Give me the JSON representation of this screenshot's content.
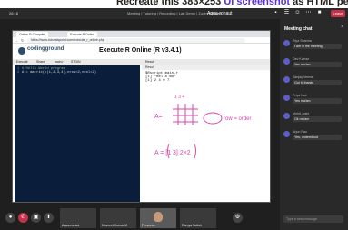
{
  "banner": {
    "part1": "Recreate this 383×253",
    "part2": "UI screenshot",
    "part3": " as HTML per the rules."
  },
  "meet": {
    "top_left": "26:16",
    "title": "Meeting | Tutoring | Recording | Lab Demo | Zoom Session",
    "presenter": "Aqua-ronaut",
    "leave_label": "Leave"
  },
  "browser": {
    "tabs": [
      "Online R Compiler",
      "Execute R Online"
    ],
    "url": "https://www.tutorialspoint.com/execute_r_online.php"
  },
  "ide": {
    "logo_text": "codingground",
    "title": "Execute R Online (R v3.4.1)",
    "toolbar": [
      "Execute",
      "Share",
      "main.r",
      "STDIN",
      "Result"
    ],
    "code_lines": [
      {
        "n": "1",
        "text": "# Hello World program",
        "comment": true
      },
      {
        "n": "2",
        "text": "A = matrix(c(1,2,3,4),nrow=2,ncol=2)",
        "comment": false
      }
    ],
    "result_bar": "Result",
    "result_text": "$Rscript main.r\n[1] \"Hello Wo\"\n[1] 2 4 0 7"
  },
  "whiteboard": {
    "label_top": "1 3 4",
    "label_A": "A=",
    "label_rowcol": "row = order",
    "label_B": "A = [1 3] 2×2"
  },
  "chat": {
    "header": "Meeting chat",
    "messages": [
      {
        "name": "Riya Sharma",
        "text": "I am in the meeting"
      },
      {
        "name": "Dev Kumar",
        "text": "Yes ma'am"
      },
      {
        "name": "Sanjay Verma",
        "text": "Got it, thanks"
      },
      {
        "name": "Priya Nair",
        "text": "Yes ma'am"
      },
      {
        "name": "Mohit Joshi",
        "text": "Ok ma'am"
      },
      {
        "name": "Arjun Rao",
        "text": "Yes, understood"
      }
    ],
    "compose_placeholder": "Type a new message"
  },
  "participants": [
    {
      "name": "Aqua-ronaut"
    },
    {
      "name": "Navneet Kumar M"
    },
    {
      "name": "Presenter"
    },
    {
      "name": "Ramya Satish"
    }
  ],
  "colors": {
    "banner_dark": "#24201c",
    "banner_accent": "#5a2de0",
    "meet_bg": "#1f1f1f",
    "leave": "#c4314b",
    "editor_bg": "#0a1e3b",
    "ink": "#d946a8"
  }
}
